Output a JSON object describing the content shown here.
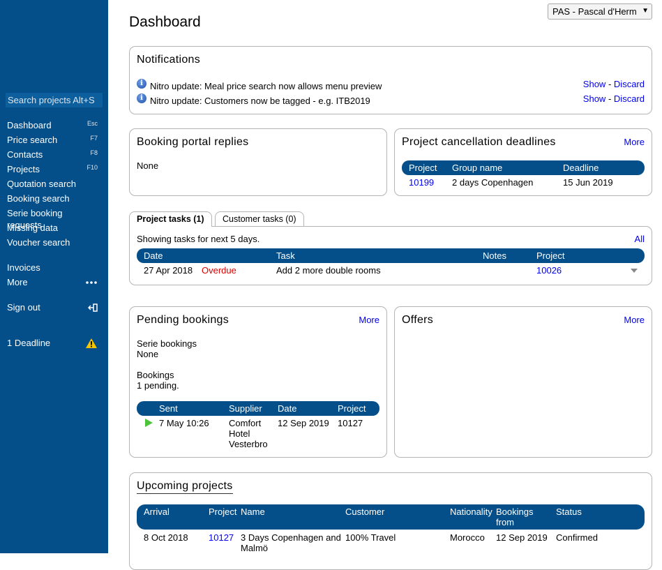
{
  "sidebar": {
    "search_placeholder": "Search projects Alt+S",
    "nav": [
      {
        "label": "Dashboard",
        "key": "Esc"
      },
      {
        "label": "Price search",
        "key": "F7"
      },
      {
        "label": "Contacts",
        "key": "F8"
      },
      {
        "label": "Projects",
        "key": "F10"
      },
      {
        "label": "Quotation search",
        "key": ""
      },
      {
        "label": "Booking search",
        "key": ""
      },
      {
        "label": "Serie booking requests",
        "key": ""
      },
      {
        "label": "Missing data",
        "key": ""
      },
      {
        "label": "Voucher search",
        "key": ""
      }
    ],
    "invoices": "Invoices",
    "more": "More",
    "sign_out": "Sign out",
    "deadline": "1 Deadline"
  },
  "header": {
    "title": "Dashboard",
    "user_select": "PAS - Pascal d'Herm"
  },
  "notifications": {
    "title": "Notifications",
    "items": [
      {
        "text": "Nitro update: Meal price search now allows menu preview",
        "show": "Show",
        "sep": "-",
        "discard": "Discard"
      },
      {
        "text": "Nitro update: Customers now be tagged - e.g. ITB2019",
        "show": "Show",
        "sep": "-",
        "discard": "Discard"
      }
    ]
  },
  "booking_portal": {
    "title": "Booking portal replies",
    "content": "None"
  },
  "cancellation": {
    "title": "Project cancellation deadlines",
    "more": "More",
    "headers": {
      "project": "Project",
      "group": "Group name",
      "deadline": "Deadline"
    },
    "rows": [
      {
        "project": "10199",
        "group": "2 days Copenhagen",
        "deadline": "15 Jun 2019"
      }
    ]
  },
  "tasks": {
    "tabs": [
      "Project tasks (1)",
      "Customer tasks (0)"
    ],
    "showing": "Showing tasks for next 5 days.",
    "all": "All",
    "headers": {
      "date": "Date",
      "task": "Task",
      "notes": "Notes",
      "project": "Project"
    },
    "rows": [
      {
        "date": "27 Apr 2018",
        "status": "Overdue",
        "task": "Add 2 more double rooms",
        "notes": "",
        "project": "10026"
      }
    ]
  },
  "pending": {
    "title": "Pending bookings",
    "more": "More",
    "serie_label": "Serie bookings",
    "serie_value": "None",
    "bookings_label": "Bookings",
    "bookings_value": "1 pending.",
    "headers": {
      "sent": "Sent",
      "supplier": "Supplier",
      "date": "Date",
      "project": "Project"
    },
    "rows": [
      {
        "sent": "7 May 10:26",
        "supplier_lines": [
          "Comfort",
          "Hotel",
          "Vesterbro"
        ],
        "date": "12 Sep 2019",
        "project": "10127"
      }
    ]
  },
  "offers": {
    "title": "Offers",
    "more": "More"
  },
  "upcoming": {
    "title": "Upcoming projects",
    "headers": {
      "arrival": "Arrival",
      "project": "Project",
      "name": "Name",
      "customer": "Customer",
      "nationality": "Nationality",
      "bookings_from_1": "Bookings",
      "bookings_from_2": "from",
      "status": "Status"
    },
    "rows": [
      {
        "arrival": "8 Oct 2018",
        "project": "10127",
        "name_1": "3 Days Copenhagen and",
        "name_2": "Malmö",
        "customer": "100% Travel",
        "nationality": "Morocco",
        "bookings_from": "12 Sep 2019",
        "status": "Confirmed"
      }
    ]
  },
  "icons": {
    "info": "info-icon",
    "more": "ellipsis-icon",
    "sign_out": "sign-out-icon",
    "warning": "warning-icon",
    "sent": "play-icon",
    "row_menu": "chevron-down-icon"
  },
  "colors": {
    "sidebar": "#044f8a",
    "table_header": "#044f8a",
    "link": "#0000ee",
    "overdue": "#d60000",
    "warning": "#f5c400",
    "sent": "#4cc33a"
  }
}
